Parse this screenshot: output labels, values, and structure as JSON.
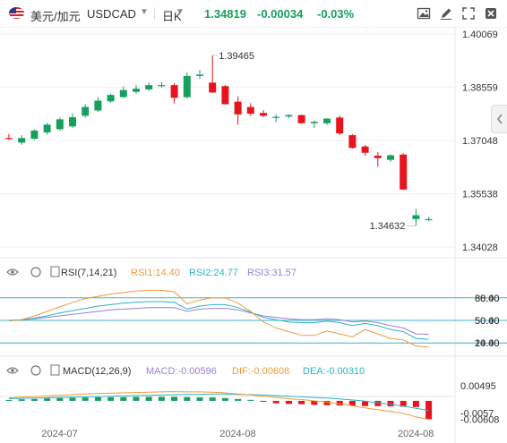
{
  "header": {
    "symbol": "美元/加元",
    "code": "USDCAD",
    "timeframe": "日K",
    "price": "1.34819",
    "change": "-0.00034",
    "change_pct": "-0.03%",
    "up_color": "#16a05c",
    "down_color": "#e8141d",
    "icons": [
      "flag-us-ca-icon",
      "chevron-down-icon",
      "chevron-down-icon",
      "image-icon",
      "pencil-icon",
      "fullscreen-icon",
      "settings-icon"
    ]
  },
  "chart_data": {
    "type": "candlestick",
    "x_ticks": [
      "2024-07",
      "2024-08",
      "2024-08"
    ],
    "price_axis": {
      "ticks": [
        "1.40069",
        "1.38559",
        "1.37048",
        "1.35538",
        "1.34028"
      ],
      "range": [
        1.338,
        1.4007
      ]
    },
    "annotations": {
      "high": "1.39465",
      "low": "1.34632"
    },
    "candles": [
      {
        "o": 1.3712,
        "h": 1.3724,
        "l": 1.3706,
        "c": 1.371
      },
      {
        "o": 1.3699,
        "h": 1.372,
        "l": 1.3693,
        "c": 1.3712
      },
      {
        "o": 1.371,
        "h": 1.3737,
        "l": 1.3707,
        "c": 1.3733
      },
      {
        "o": 1.3728,
        "h": 1.3755,
        "l": 1.3722,
        "c": 1.375
      },
      {
        "o": 1.3737,
        "h": 1.377,
        "l": 1.3733,
        "c": 1.3765
      },
      {
        "o": 1.3745,
        "h": 1.3782,
        "l": 1.374,
        "c": 1.3771
      },
      {
        "o": 1.3775,
        "h": 1.3808,
        "l": 1.377,
        "c": 1.38
      },
      {
        "o": 1.379,
        "h": 1.3828,
        "l": 1.3786,
        "c": 1.3818
      },
      {
        "o": 1.3816,
        "h": 1.3838,
        "l": 1.3812,
        "c": 1.3834
      },
      {
        "o": 1.3828,
        "h": 1.3858,
        "l": 1.3826,
        "c": 1.3848
      },
      {
        "o": 1.3843,
        "h": 1.3862,
        "l": 1.3838,
        "c": 1.3852
      },
      {
        "o": 1.385,
        "h": 1.387,
        "l": 1.3846,
        "c": 1.3862
      },
      {
        "o": 1.386,
        "h": 1.387,
        "l": 1.3855,
        "c": 1.3862
      },
      {
        "o": 1.3862,
        "h": 1.3868,
        "l": 1.381,
        "c": 1.3826
      },
      {
        "o": 1.3828,
        "h": 1.3898,
        "l": 1.3824,
        "c": 1.3888
      },
      {
        "o": 1.3888,
        "h": 1.3905,
        "l": 1.388,
        "c": 1.3892
      },
      {
        "o": 1.3869,
        "h": 1.39465,
        "l": 1.384,
        "c": 1.3841
      },
      {
        "o": 1.3859,
        "h": 1.3863,
        "l": 1.3807,
        "c": 1.3808
      },
      {
        "o": 1.3815,
        "h": 1.383,
        "l": 1.375,
        "c": 1.3779
      },
      {
        "o": 1.38,
        "h": 1.3811,
        "l": 1.3775,
        "c": 1.3781
      },
      {
        "o": 1.3783,
        "h": 1.3791,
        "l": 1.3771,
        "c": 1.3775
      },
      {
        "o": 1.3772,
        "h": 1.3779,
        "l": 1.3757,
        "c": 1.3772
      },
      {
        "o": 1.3773,
        "h": 1.378,
        "l": 1.3768,
        "c": 1.3777
      },
      {
        "o": 1.3777,
        "h": 1.3778,
        "l": 1.3752,
        "c": 1.3754
      },
      {
        "o": 1.3754,
        "h": 1.3762,
        "l": 1.374,
        "c": 1.3758
      },
      {
        "o": 1.3754,
        "h": 1.3768,
        "l": 1.3749,
        "c": 1.3767
      },
      {
        "o": 1.377,
        "h": 1.3776,
        "l": 1.372,
        "c": 1.3725
      },
      {
        "o": 1.372,
        "h": 1.3723,
        "l": 1.3682,
        "c": 1.3684
      },
      {
        "o": 1.3688,
        "h": 1.3692,
        "l": 1.3662,
        "c": 1.367
      },
      {
        "o": 1.3662,
        "h": 1.3672,
        "l": 1.363,
        "c": 1.3655
      },
      {
        "o": 1.365,
        "h": 1.3666,
        "l": 1.3644,
        "c": 1.3663
      },
      {
        "o": 1.3665,
        "h": 1.3669,
        "l": 1.3564,
        "c": 1.3566
      },
      {
        "o": 1.3482,
        "h": 1.3511,
        "l": 1.34632,
        "c": 1.3493
      },
      {
        "o": 1.3482,
        "h": 1.3488,
        "l": 1.3476,
        "c": 1.3482
      }
    ],
    "rsi": {
      "label": "RSI(7,14,21)",
      "rsi1": "RSI1:14.40",
      "rsi2": "RSI2:24.77",
      "rsi3": "RSI3:31.57",
      "levels": [
        "80.00",
        "50.00",
        "20.00"
      ],
      "right_labels": [
        "80.00",
        "88.40",
        "50.00",
        "50.40",
        "20.00",
        "14.40"
      ],
      "series1": [
        49,
        51,
        56,
        62,
        68,
        74,
        79,
        82,
        85,
        87,
        89,
        90,
        90,
        88,
        72,
        77,
        80,
        80,
        73,
        62,
        48,
        40,
        35,
        30,
        30,
        36,
        32,
        28,
        38,
        32,
        26,
        24,
        16,
        14.4
      ],
      "series2": [
        50,
        51,
        53,
        56,
        60,
        63,
        66,
        69,
        71,
        73,
        74,
        75,
        75,
        74,
        65,
        69,
        71,
        71,
        67,
        61,
        54,
        51,
        48,
        47,
        47,
        49,
        47,
        43,
        46,
        43,
        38,
        35,
        26,
        24.77
      ],
      "series3": [
        50,
        51,
        52,
        54,
        56,
        58,
        60,
        62,
        64,
        65,
        66,
        67,
        67,
        67,
        62,
        65,
        66,
        66,
        64,
        60,
        56,
        54,
        52,
        51,
        51,
        52,
        51,
        48,
        49,
        47,
        43,
        40,
        32,
        31.57
      ]
    },
    "macd": {
      "label": "MACD(12,26,9)",
      "macd_txt": "MACD:-0.00596",
      "dif_txt": "DIF:-0.00608",
      "dea_txt": "DEA:-0.00310",
      "right_labels": [
        "0.00495",
        "-0.0057",
        "-0.00608"
      ],
      "hist": [
        0.0003,
        0.0005,
        0.0006,
        0.0008,
        0.0009,
        0.001,
        0.0011,
        0.0012,
        0.0012,
        0.0012,
        0.0013,
        0.0013,
        0.0013,
        0.0013,
        0.0012,
        0.0011,
        0.0011,
        0.0009,
        0.0006,
        0.0003,
        -0.0001,
        -0.0008,
        -0.001,
        -0.0011,
        -0.0013,
        -0.0014,
        -0.0015,
        -0.0016,
        -0.0017,
        -0.0017,
        -0.0018,
        -0.0019,
        -0.002,
        -0.00596
      ],
      "dif": [
        0.001,
        0.0012,
        0.0014,
        0.0016,
        0.0018,
        0.002,
        0.0022,
        0.0024,
        0.0025,
        0.0026,
        0.0027,
        0.0028,
        0.0029,
        0.003,
        0.0029,
        0.0029,
        0.0028,
        0.0026,
        0.0022,
        0.0019,
        0.0015,
        0.0011,
        0.0007,
        0.0004,
        0.0,
        -0.0004,
        -0.0009,
        -0.0016,
        -0.0023,
        -0.0029,
        -0.0034,
        -0.0041,
        -0.0052,
        -0.00608
      ],
      "dea": [
        0.0007,
        0.0008,
        0.0009,
        0.001,
        0.0011,
        0.0012,
        0.0013,
        0.0014,
        0.0015,
        0.0016,
        0.0017,
        0.0018,
        0.0019,
        0.002,
        0.0021,
        0.0021,
        0.0022,
        0.0022,
        0.0021,
        0.002,
        0.0019,
        0.0017,
        0.0015,
        0.0013,
        0.0011,
        0.0009,
        0.0006,
        0.0003,
        -0.0001,
        -0.0006,
        -0.0011,
        -0.0017,
        -0.0024,
        -0.0031
      ],
      "range": [
        -0.007,
        0.0052
      ]
    }
  }
}
